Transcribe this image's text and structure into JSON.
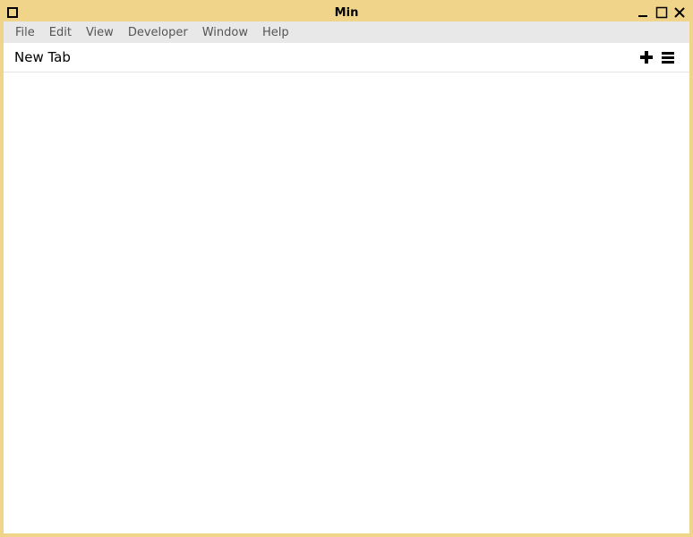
{
  "window": {
    "title": "Min"
  },
  "menubar": {
    "items": [
      "File",
      "Edit",
      "View",
      "Developer",
      "Window",
      "Help"
    ]
  },
  "tabbar": {
    "tab_title": "New Tab"
  }
}
